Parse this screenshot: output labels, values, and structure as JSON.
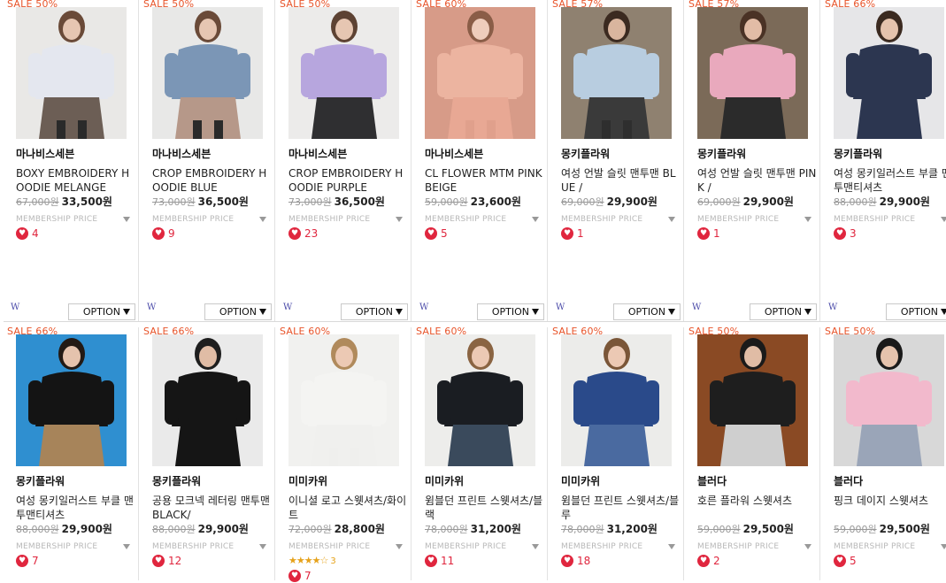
{
  "rows": [
    {
      "items": [
        {
          "badge": "SALE 50%",
          "brand": "마나비스세븐",
          "title": "BOXY EMBROIDERY HOODIE MELANGE",
          "orig_price": "67,000원",
          "sale_price": "33,500원",
          "membership": "MEMBERSHIP PRICE",
          "likes": "4",
          "w": "W",
          "option": "OPTION",
          "photo": {
            "bg": "#e9e8e6",
            "top": "#e4e7ef",
            "bottom": "#6c5e55",
            "skin": "#e6c6b2",
            "hair": "#6a4a38",
            "legs": "#2a2a2a"
          }
        },
        {
          "badge": "SALE 50%",
          "brand": "마나비스세븐",
          "title": "CROP EMBROIDERY HOODIE BLUE",
          "orig_price": "73,000원",
          "sale_price": "36,500원",
          "membership": "MEMBERSHIP PRICE",
          "likes": "9",
          "w": "W",
          "option": "OPTION",
          "photo": {
            "bg": "#e8e8e7",
            "top": "#7b96b6",
            "bottom": "#b69889",
            "skin": "#e6c6b2",
            "hair": "#6a4a38",
            "legs": "#2a2a2a"
          }
        },
        {
          "badge": "SALE 50%",
          "brand": "마나비스세븐",
          "title": "CROP EMBROIDERY HOODIE PURPLE",
          "orig_price": "73,000원",
          "sale_price": "36,500원",
          "membership": "MEMBERSHIP PRICE",
          "likes": "23",
          "w": "W",
          "option": "OPTION",
          "photo": {
            "bg": "#ecebea",
            "top": "#b7a6de",
            "bottom": "#2f2f31",
            "skin": "#e6c6b2",
            "hair": "#5d4233",
            "legs": "#2f2f31"
          }
        },
        {
          "badge": "SALE 60%",
          "brand": "마나비스세븐",
          "title": "CL FLOWER MTM PINK BEIGE",
          "orig_price": "59,000원",
          "sale_price": "23,600원",
          "membership": "MEMBERSHIP PRICE",
          "likes": "5",
          "w": "W",
          "option": "OPTION",
          "photo": {
            "bg": "#d79b88",
            "top": "#ecb4a0",
            "bottom": "#e8a894",
            "skin": "#efcdbc",
            "hair": "#8a5d47",
            "legs": "#e0a08c"
          }
        },
        {
          "badge": "SALE 57%",
          "brand": "몽키플라워",
          "title": "여성 언발 슬릿 맨투맨 BLUE /",
          "orig_price": "69,000원",
          "sale_price": "29,900원",
          "membership": "MEMBERSHIP PRICE",
          "likes": "1",
          "w": "W",
          "option": "OPTION",
          "photo": {
            "bg": "#8f8170",
            "top": "#b8cde0",
            "bottom": "#3a3a3a",
            "skin": "#d9b59e",
            "hair": "#3b2a20",
            "legs": "#2e2e2e"
          }
        },
        {
          "badge": "SALE 57%",
          "brand": "몽키플라워",
          "title": "여성 언발 슬릿 맨투맨 PINK /",
          "orig_price": "69,000원",
          "sale_price": "29,900원",
          "membership": "MEMBERSHIP PRICE",
          "likes": "1",
          "w": "W",
          "option": "OPTION",
          "photo": {
            "bg": "#7b6a58",
            "top": "#e9a9bd",
            "bottom": "#2b2b2b",
            "skin": "#e2bca6",
            "hair": "#4a3225",
            "legs": "#2b2b2b"
          }
        },
        {
          "badge": "SALE 66%",
          "brand": "몽키플라워",
          "title": "여성 몽키일러스트 부클 맨투맨티셔츠",
          "orig_price": "88,000원",
          "sale_price": "29,900원",
          "membership": "MEMBERSHIP PRICE",
          "likes": "3",
          "w": "W",
          "option": "OPTION",
          "photo": {
            "bg": "#e6e6e8",
            "top": "#2c3650",
            "bottom": "#2c3650",
            "skin": "#e5c3ad",
            "hair": "#3b2a20",
            "legs": "#2c3650"
          }
        }
      ]
    },
    {
      "items": [
        {
          "badge": "SALE 66%",
          "brand": "몽키플라워",
          "title": "여성 몽키일러스트 부클 맨투맨티셔츠",
          "orig_price": "88,000원",
          "sale_price": "29,900원",
          "membership": "MEMBERSHIP PRICE",
          "likes": "7",
          "photo": {
            "bg": "#2f8fd0",
            "top": "#141414",
            "bottom": "#a7845a",
            "skin": "#e5c3ad",
            "hair": "#231a14",
            "legs": "#a7845a"
          }
        },
        {
          "badge": "SALE 66%",
          "brand": "몽키플라워",
          "title": "공용 모크넥 레터링 맨투맨 BLACK/",
          "orig_price": "88,000원",
          "sale_price": "29,900원",
          "membership": "MEMBERSHIP PRICE",
          "likes": "12",
          "photo": {
            "bg": "#eaeaea",
            "top": "#151515",
            "bottom": "#151515",
            "skin": "#e0bca5",
            "hair": "#1e1e1e",
            "legs": "#151515"
          }
        },
        {
          "badge": "SALE 60%",
          "brand": "미미카위",
          "title": "이니셜 로고 스웻셔츠/화이트",
          "orig_price": "72,000원",
          "sale_price": "28,800원",
          "membership": "MEMBERSHIP PRICE",
          "rating_stars": "★★★★☆",
          "rating_count": "3",
          "likes": "7",
          "photo": {
            "bg": "#f1f1ef",
            "top": "#f4f4f2",
            "bottom": "#f0f0ee",
            "skin": "#ecc9b4",
            "hair": "#b08a5c",
            "legs": "#efefed"
          }
        },
        {
          "badge": "SALE 60%",
          "brand": "미미카위",
          "title": "윔블던 프린트 스웻셔츠/블랙",
          "orig_price": "78,000원",
          "sale_price": "31,200원",
          "membership": "MEMBERSHIP PRICE",
          "likes": "11",
          "photo": {
            "bg": "#ededeb",
            "top": "#1a1d22",
            "bottom": "#3a4a5c",
            "skin": "#ecc9b4",
            "hair": "#8a6442",
            "legs": "#3a4a5c"
          }
        },
        {
          "badge": "SALE 60%",
          "brand": "미미카위",
          "title": "윔블던 프린트 스웻셔츠/블루",
          "orig_price": "78,000원",
          "sale_price": "31,200원",
          "membership": "MEMBERSHIP PRICE",
          "likes": "18",
          "photo": {
            "bg": "#ececea",
            "top": "#2a4a8a",
            "bottom": "#4a6aa0",
            "skin": "#ecc9b4",
            "hair": "#7a5638",
            "legs": "#4a6aa0"
          }
        },
        {
          "badge": "SALE 50%",
          "brand": "블러다",
          "title": "호른 플라워 스웻셔츠",
          "orig_price": "59,000원",
          "sale_price": "29,500원",
          "membership": "MEMBERSHIP PRICE",
          "likes": "2",
          "photo": {
            "bg": "#8a4a24",
            "top": "#1e1e1e",
            "bottom": "#cfcfcf",
            "skin": "#e0bca5",
            "hair": "#1a1a1a",
            "legs": "#cfcfcf"
          }
        },
        {
          "badge": "SALE 50%",
          "brand": "블러다",
          "title": "핑크 데이지 스웻셔츠",
          "orig_price": "59,000원",
          "sale_price": "29,500원",
          "membership": "MEMBERSHIP PRICE",
          "likes": "5",
          "photo": {
            "bg": "#d8d8d8",
            "top": "#f2b9cc",
            "bottom": "#9aa5b8",
            "skin": "#e5c3ad",
            "hair": "#1a1a1a",
            "legs": "#9aa5b8"
          }
        }
      ]
    }
  ]
}
